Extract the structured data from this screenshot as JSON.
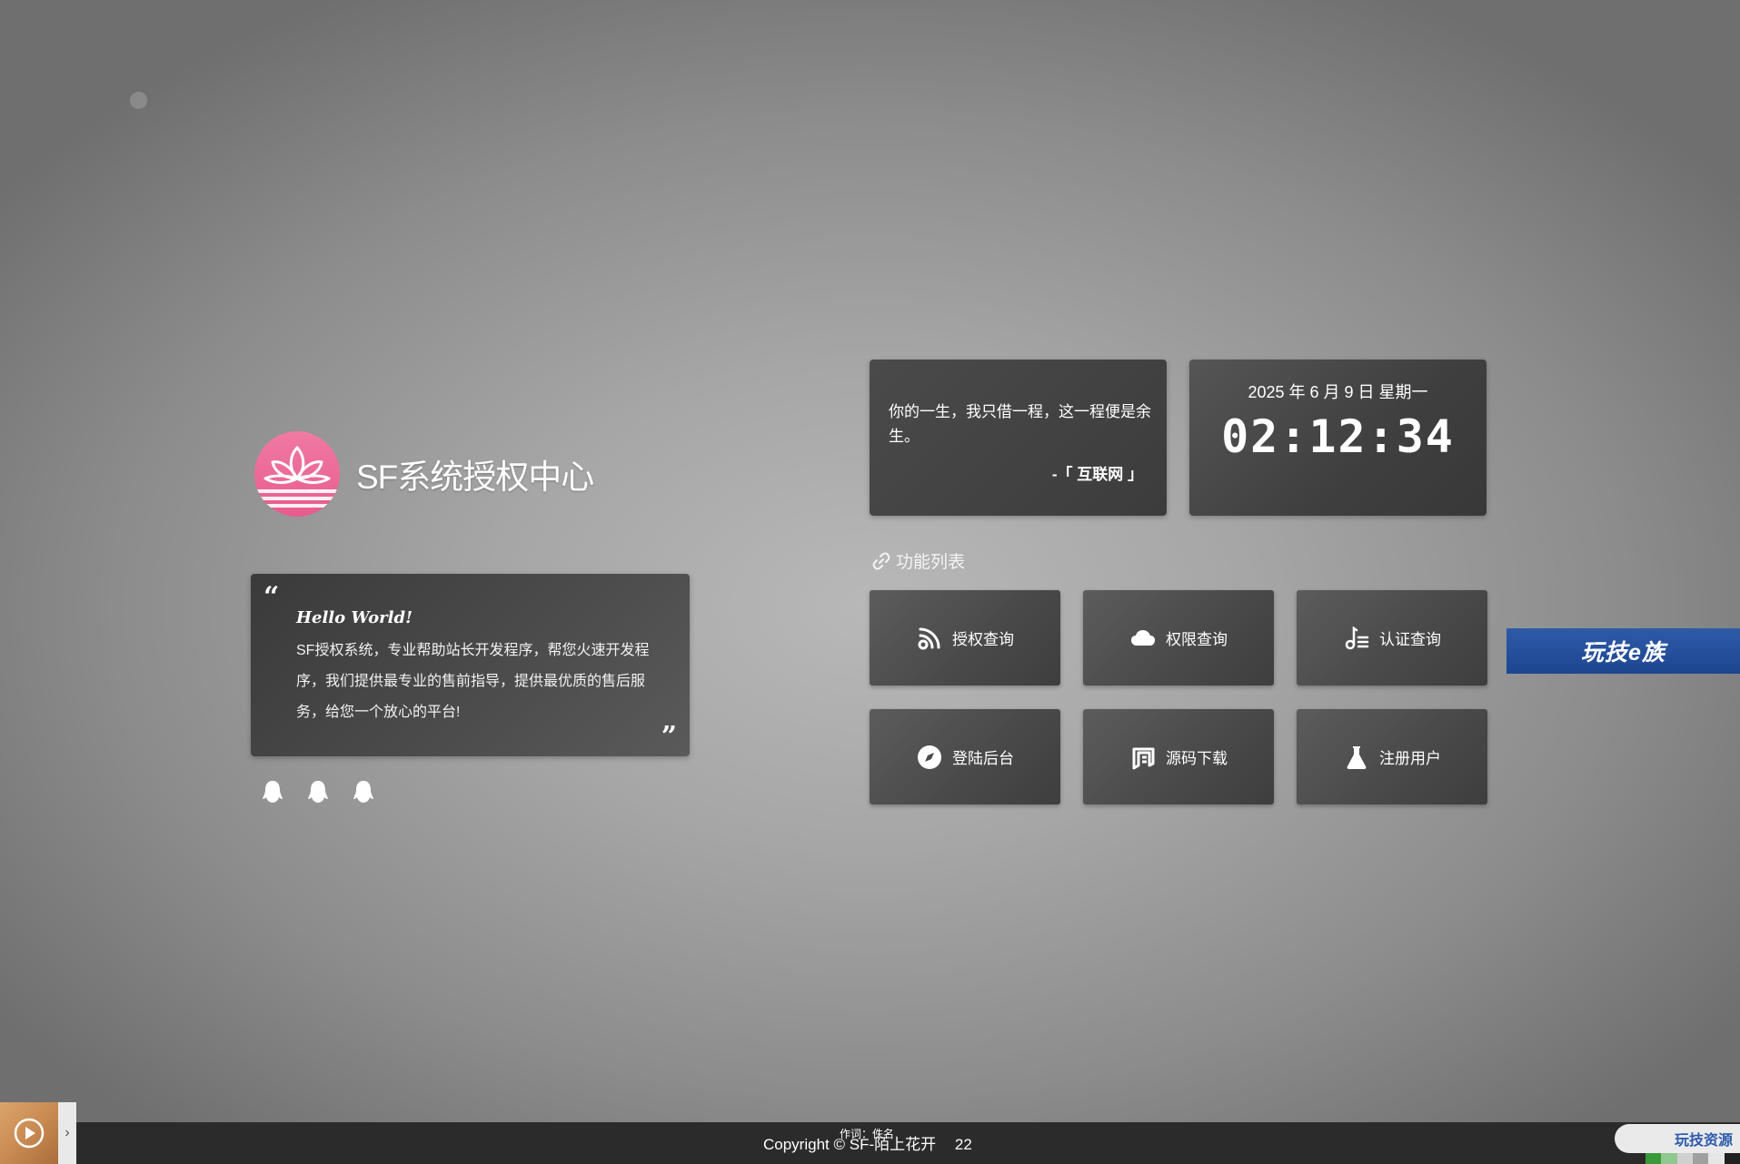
{
  "site": {
    "title": "SF系统授权中心"
  },
  "intro": {
    "hello": "Hello World!",
    "text": "SF授权系统，专业帮助站长开发程序，帮您火速开发程序，我们提供最专业的售前指导，提供最优质的售后服务，给您一个放心的平台!",
    "quote_open": "“",
    "quote_close": "”"
  },
  "quote": {
    "text": "你的一生，我只借一程，这一程便是余生。",
    "source": "-「 互联网 」"
  },
  "clock": {
    "date": "2025 年 6 月 9 日 星期一",
    "time": "02:12:34"
  },
  "functions": {
    "heading": "功能列表",
    "items": [
      {
        "label": "授权查询",
        "icon": "rss-icon"
      },
      {
        "label": "权限查询",
        "icon": "cloud-icon"
      },
      {
        "label": "认证查询",
        "icon": "music-list-icon"
      },
      {
        "label": "登陆后台",
        "icon": "compass-icon"
      },
      {
        "label": "源码下载",
        "icon": "document-icon"
      },
      {
        "label": "注册用户",
        "icon": "flask-icon"
      }
    ]
  },
  "side_badge": {
    "text": "玩技e族"
  },
  "footer": {
    "lyric": "作词：佚名",
    "copyright": "Copyright © SF-陌上花开",
    "count": "22",
    "badge": "玩技资源"
  },
  "colors": {
    "logo_pink": "#e85b8e",
    "card_dark": "#3c3c3c",
    "badge_blue": "#2d5bab"
  }
}
